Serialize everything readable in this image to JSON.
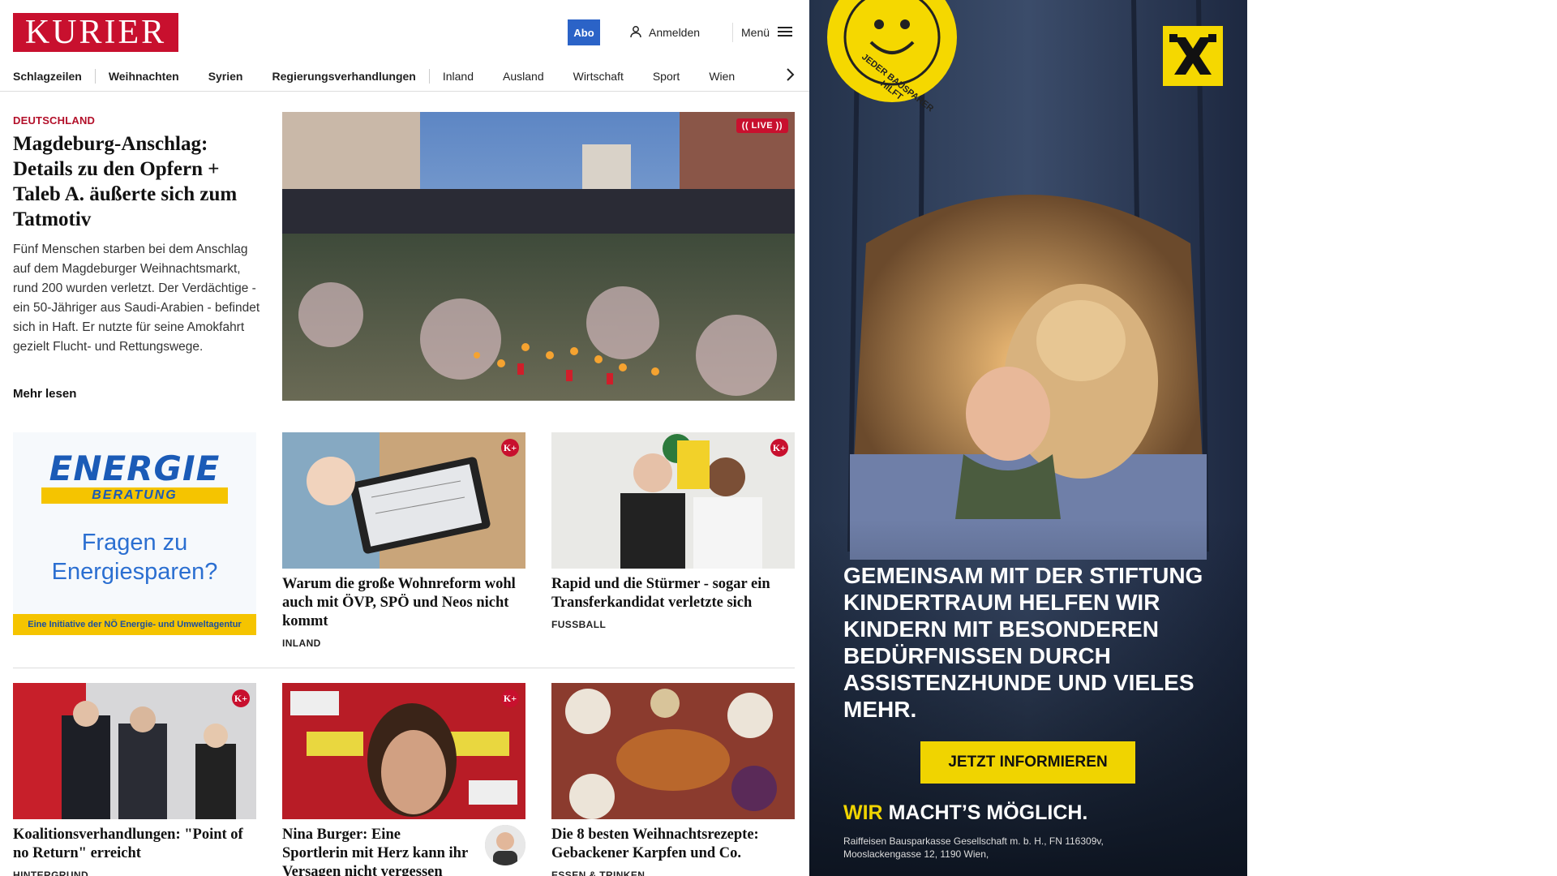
{
  "header": {
    "logo_text": "KURIER",
    "abo_label": "Abo",
    "login_label": "Anmelden",
    "menu_label": "Menü"
  },
  "nav": {
    "items": [
      "Schlagzeilen",
      "Weihnachten",
      "Syrien",
      "Regierungsverhandlungen",
      "Inland",
      "Ausland",
      "Wirtschaft",
      "Sport",
      "Wien"
    ]
  },
  "lead": {
    "kicker": "DEUTSCHLAND",
    "title": "Magdeburg-Anschlag: Details zu den Opfern + Taleb A. äußerte sich zum Tatmotiv",
    "text": "Fünf Menschen starben bei dem Anschlag auf dem Magdeburger Weihnachtsmarkt, rund 200 wurden verletzt. Der Verdächtige - ein 50-Jähriger aus Saudi-Arabien - befindet sich in Haft. Er nutzte für seine Amokfahrt gezielt Flucht- und Rettungswege.",
    "more": "Mehr lesen",
    "live_badge": "(( LIVE ))"
  },
  "energie_ad": {
    "logo": "ENERGIE",
    "sub": "BERATUNG",
    "question": "Fragen zu Energiesparen?",
    "footer": "Eine Initiative der NÖ Energie- und Umweltagentur"
  },
  "cards": [
    {
      "title": "Warum die große Wohnreform wohl auch mit ÖVP, SPÖ und Neos nicht kommt",
      "tag": "INLAND",
      "badge": "K+"
    },
    {
      "title": "Rapid und die Stürmer - sogar ein Transferkandidat verletzte sich",
      "tag": "FUSSBALL",
      "badge": "K+"
    },
    {
      "title": "Koalitionsverhandlungen: \"Point of no Return\" erreicht",
      "tag": "HINTERGRUND",
      "badge": "K+"
    },
    {
      "title": "Nina Burger: Eine Sportlerin mit Herz kann ihr Versagen nicht vergessen",
      "tag": "",
      "badge": "K+"
    },
    {
      "title": "Die 8 besten Weihnachtsrezepte: Gebackener Karpfen und Co.",
      "tag": "ESSEN & TRINKEN",
      "badge": ""
    }
  ],
  "side_ad": {
    "seal_text": "JEDER BAUSPARER HILFT",
    "headline": "GEMEINSAM MIT DER STIFTUNG KINDERTRAUM HELFEN WIR KINDERN MIT BESONDEREN BEDÜRFNISSEN DURCH ASSISTENZHUNDE UND VIELES MEHR.",
    "cta": "JETZT INFORMIEREN",
    "slogan_wir": "WIR",
    "slogan_rest": "MACHT’S MÖGLICH.",
    "legal": "Raiffeisen Bausparkasse Gesellschaft m. b. H., FN 116309v, Mooslackengasse 12, 1190 Wien,"
  },
  "colors": {
    "brand_red": "#c8102e",
    "abo_blue": "#2b63c7",
    "ad_yellow": "#f0d400"
  }
}
